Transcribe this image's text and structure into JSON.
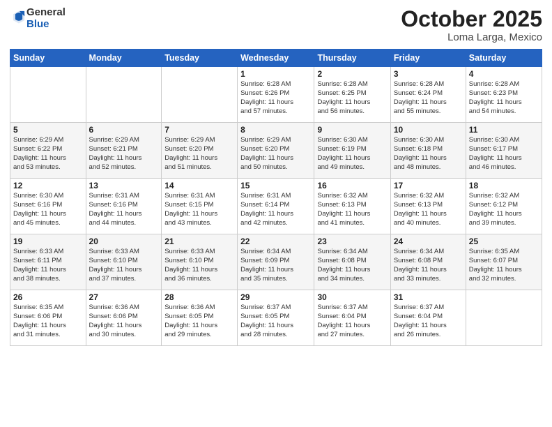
{
  "header": {
    "logo_general": "General",
    "logo_blue": "Blue",
    "month_title": "October 2025",
    "location": "Loma Larga, Mexico"
  },
  "days_of_week": [
    "Sunday",
    "Monday",
    "Tuesday",
    "Wednesday",
    "Thursday",
    "Friday",
    "Saturday"
  ],
  "weeks": [
    [
      {
        "day": "",
        "info": ""
      },
      {
        "day": "",
        "info": ""
      },
      {
        "day": "",
        "info": ""
      },
      {
        "day": "1",
        "info": "Sunrise: 6:28 AM\nSunset: 6:26 PM\nDaylight: 11 hours\nand 57 minutes."
      },
      {
        "day": "2",
        "info": "Sunrise: 6:28 AM\nSunset: 6:25 PM\nDaylight: 11 hours\nand 56 minutes."
      },
      {
        "day": "3",
        "info": "Sunrise: 6:28 AM\nSunset: 6:24 PM\nDaylight: 11 hours\nand 55 minutes."
      },
      {
        "day": "4",
        "info": "Sunrise: 6:28 AM\nSunset: 6:23 PM\nDaylight: 11 hours\nand 54 minutes."
      }
    ],
    [
      {
        "day": "5",
        "info": "Sunrise: 6:29 AM\nSunset: 6:22 PM\nDaylight: 11 hours\nand 53 minutes."
      },
      {
        "day": "6",
        "info": "Sunrise: 6:29 AM\nSunset: 6:21 PM\nDaylight: 11 hours\nand 52 minutes."
      },
      {
        "day": "7",
        "info": "Sunrise: 6:29 AM\nSunset: 6:20 PM\nDaylight: 11 hours\nand 51 minutes."
      },
      {
        "day": "8",
        "info": "Sunrise: 6:29 AM\nSunset: 6:20 PM\nDaylight: 11 hours\nand 50 minutes."
      },
      {
        "day": "9",
        "info": "Sunrise: 6:30 AM\nSunset: 6:19 PM\nDaylight: 11 hours\nand 49 minutes."
      },
      {
        "day": "10",
        "info": "Sunrise: 6:30 AM\nSunset: 6:18 PM\nDaylight: 11 hours\nand 48 minutes."
      },
      {
        "day": "11",
        "info": "Sunrise: 6:30 AM\nSunset: 6:17 PM\nDaylight: 11 hours\nand 46 minutes."
      }
    ],
    [
      {
        "day": "12",
        "info": "Sunrise: 6:30 AM\nSunset: 6:16 PM\nDaylight: 11 hours\nand 45 minutes."
      },
      {
        "day": "13",
        "info": "Sunrise: 6:31 AM\nSunset: 6:16 PM\nDaylight: 11 hours\nand 44 minutes."
      },
      {
        "day": "14",
        "info": "Sunrise: 6:31 AM\nSunset: 6:15 PM\nDaylight: 11 hours\nand 43 minutes."
      },
      {
        "day": "15",
        "info": "Sunrise: 6:31 AM\nSunset: 6:14 PM\nDaylight: 11 hours\nand 42 minutes."
      },
      {
        "day": "16",
        "info": "Sunrise: 6:32 AM\nSunset: 6:13 PM\nDaylight: 11 hours\nand 41 minutes."
      },
      {
        "day": "17",
        "info": "Sunrise: 6:32 AM\nSunset: 6:13 PM\nDaylight: 11 hours\nand 40 minutes."
      },
      {
        "day": "18",
        "info": "Sunrise: 6:32 AM\nSunset: 6:12 PM\nDaylight: 11 hours\nand 39 minutes."
      }
    ],
    [
      {
        "day": "19",
        "info": "Sunrise: 6:33 AM\nSunset: 6:11 PM\nDaylight: 11 hours\nand 38 minutes."
      },
      {
        "day": "20",
        "info": "Sunrise: 6:33 AM\nSunset: 6:10 PM\nDaylight: 11 hours\nand 37 minutes."
      },
      {
        "day": "21",
        "info": "Sunrise: 6:33 AM\nSunset: 6:10 PM\nDaylight: 11 hours\nand 36 minutes."
      },
      {
        "day": "22",
        "info": "Sunrise: 6:34 AM\nSunset: 6:09 PM\nDaylight: 11 hours\nand 35 minutes."
      },
      {
        "day": "23",
        "info": "Sunrise: 6:34 AM\nSunset: 6:08 PM\nDaylight: 11 hours\nand 34 minutes."
      },
      {
        "day": "24",
        "info": "Sunrise: 6:34 AM\nSunset: 6:08 PM\nDaylight: 11 hours\nand 33 minutes."
      },
      {
        "day": "25",
        "info": "Sunrise: 6:35 AM\nSunset: 6:07 PM\nDaylight: 11 hours\nand 32 minutes."
      }
    ],
    [
      {
        "day": "26",
        "info": "Sunrise: 6:35 AM\nSunset: 6:06 PM\nDaylight: 11 hours\nand 31 minutes."
      },
      {
        "day": "27",
        "info": "Sunrise: 6:36 AM\nSunset: 6:06 PM\nDaylight: 11 hours\nand 30 minutes."
      },
      {
        "day": "28",
        "info": "Sunrise: 6:36 AM\nSunset: 6:05 PM\nDaylight: 11 hours\nand 29 minutes."
      },
      {
        "day": "29",
        "info": "Sunrise: 6:37 AM\nSunset: 6:05 PM\nDaylight: 11 hours\nand 28 minutes."
      },
      {
        "day": "30",
        "info": "Sunrise: 6:37 AM\nSunset: 6:04 PM\nDaylight: 11 hours\nand 27 minutes."
      },
      {
        "day": "31",
        "info": "Sunrise: 6:37 AM\nSunset: 6:04 PM\nDaylight: 11 hours\nand 26 minutes."
      },
      {
        "day": "",
        "info": ""
      }
    ]
  ]
}
